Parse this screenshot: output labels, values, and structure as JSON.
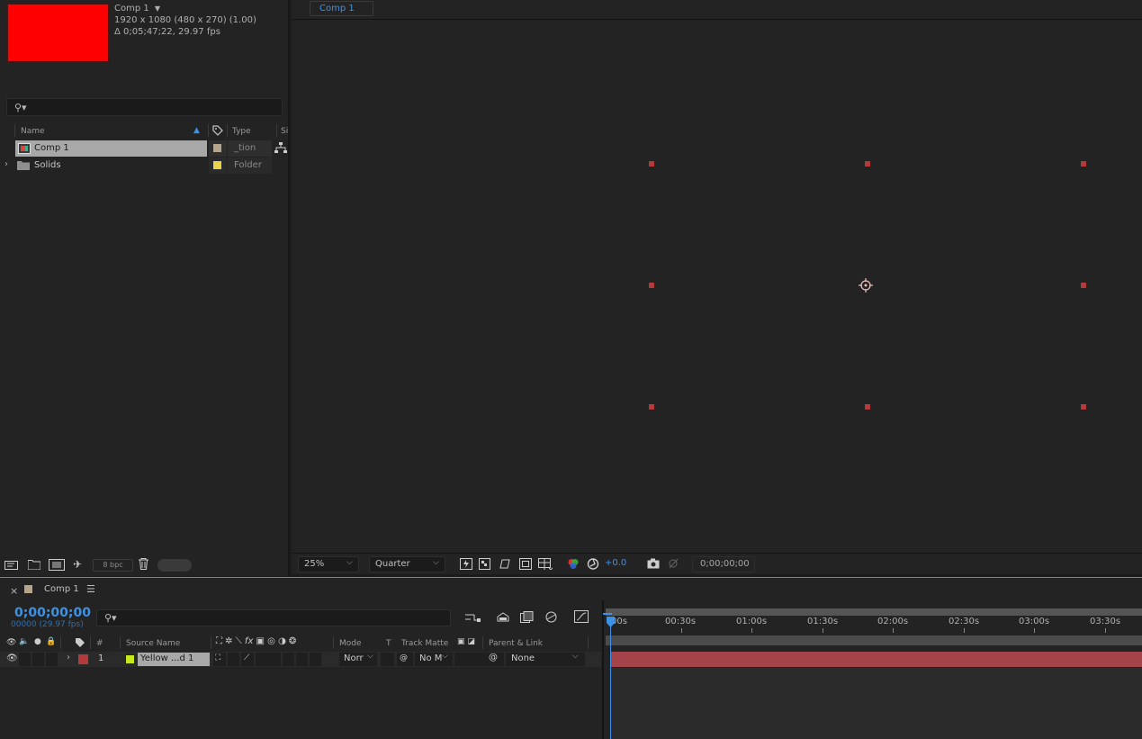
{
  "project": {
    "item_name": "Comp 1",
    "item_menu_icon": "triangle-down",
    "item_size": "1920 x 1080  (480 x 270) (1.00)",
    "item_duration": "Δ 0;05;47;22, 29.97 fps",
    "thumbnail_color": "#ff0000",
    "search_icon": "search-icon",
    "columns": {
      "name": "Name",
      "type": "Type",
      "size": "Si"
    },
    "items": [
      {
        "name": "Comp 1",
        "type": "_tion",
        "label_color": "#b5a58a",
        "icon": "composition-icon",
        "selected": true
      },
      {
        "name": "Solids",
        "type": "Folder",
        "label_color": "#e8d34a",
        "icon": "folder-icon",
        "selected": false
      }
    ],
    "footer": {
      "bpc": "8 bpc"
    }
  },
  "composition": {
    "tab_label": "Comp 1",
    "zoom": "25%",
    "resolution": "Quarter",
    "exposure": "+0.0",
    "current_time": "0;00;00;00"
  },
  "timeline": {
    "tab_label": "Comp 1",
    "tab_color": "#b5a58a",
    "current_time": "0;00;00;00",
    "frame_info": "00000 (29.97 fps)",
    "columns": {
      "source_name": "Source Name",
      "mode": "Mode",
      "t": "T",
      "track_matte": "Track Matte",
      "parent_link": "Parent & Link"
    },
    "layers": [
      {
        "index": "1",
        "name": "Yellow ...d 1",
        "label_color": "#b33a3a",
        "swatch_color": "#c8e81e",
        "mode": "Norr",
        "track_matte": "No M",
        "parent": "None"
      }
    ],
    "ruler": [
      "00s",
      "00:30s",
      "01:00s",
      "01:30s",
      "02:00s",
      "02:30s",
      "03:00s",
      "03:30s"
    ],
    "layer_bar_color": "#a5434b",
    "accent_color": "#3d92e6"
  }
}
